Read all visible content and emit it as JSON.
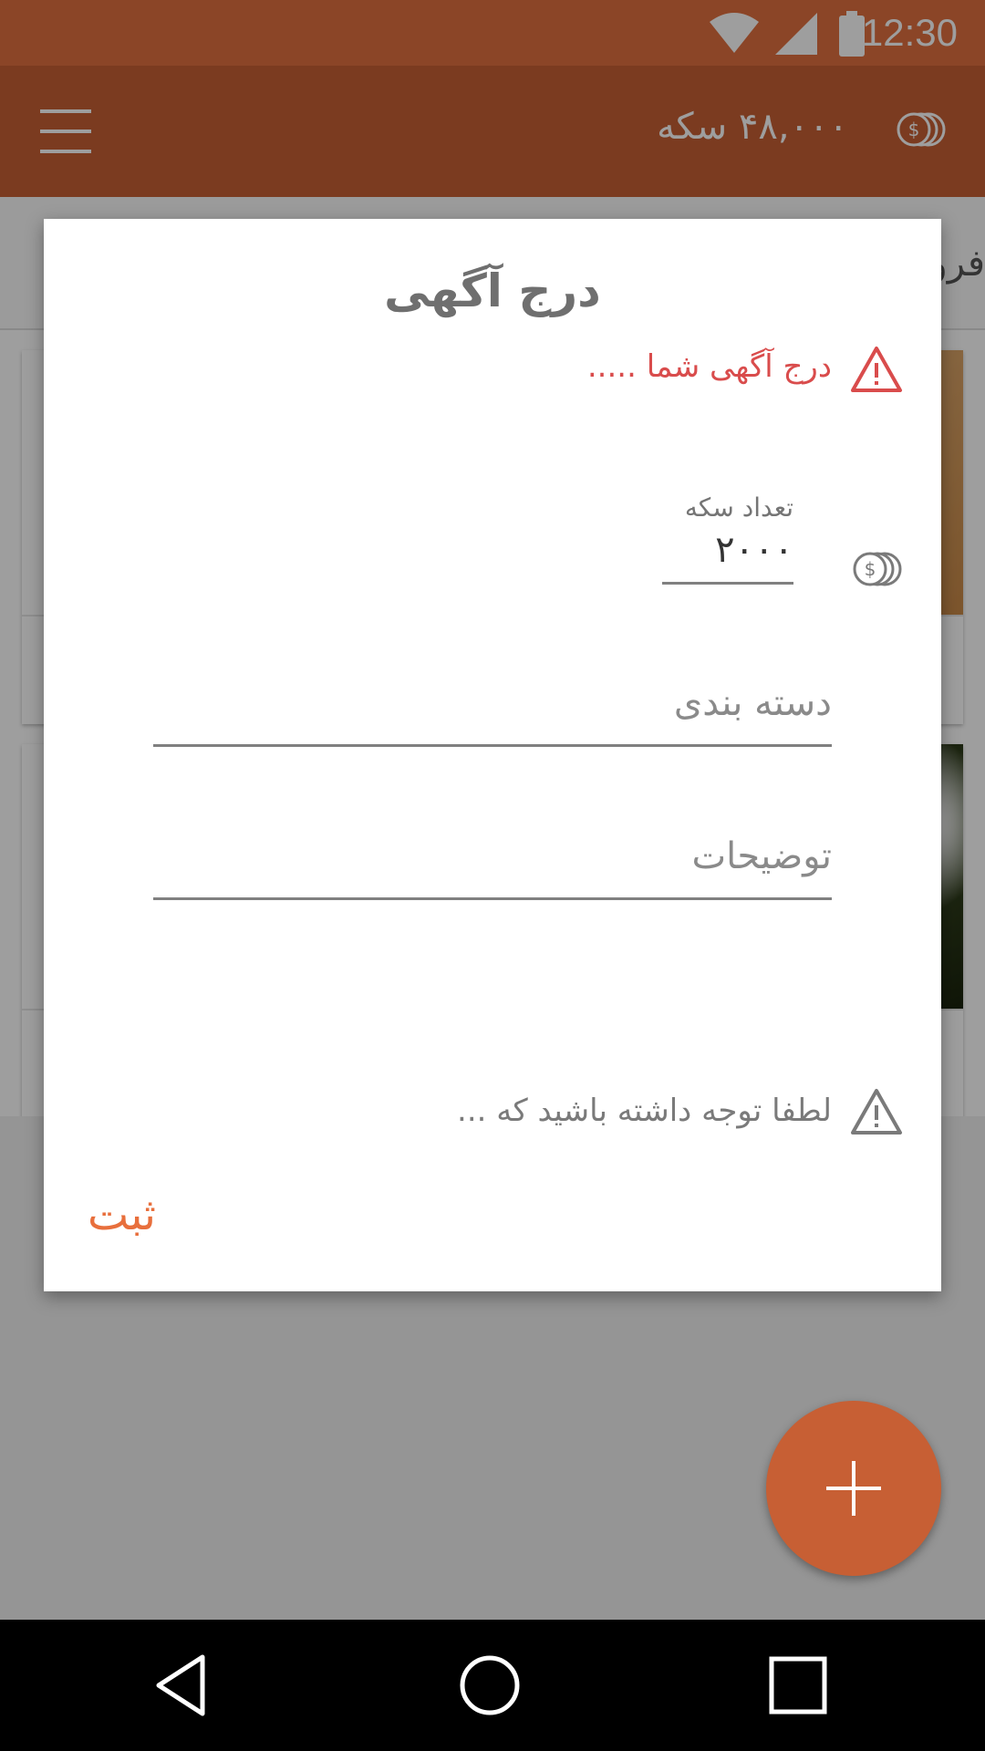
{
  "status_bar": {
    "time": "12:30",
    "icons": [
      "wifi-icon",
      "cellular-signal-icon",
      "battery-icon"
    ]
  },
  "app_bar": {
    "coin_balance": "۴۸,۰۰۰ سکه",
    "icons": [
      "menu-icon",
      "coins-icon"
    ],
    "color": "#C75F34"
  },
  "background": {
    "tab_label": "فرو"
  },
  "dialog": {
    "title": "درج آگهی",
    "alert_text": "درج آگهی شما .....",
    "coin_field": {
      "label": "تعداد سکه",
      "value": "۲۰۰۰"
    },
    "category_placeholder": "دسته بندی",
    "description_placeholder": "توضیحات",
    "note_text": "لطفا توجه داشته باشید که ...",
    "submit_label": "ثبت"
  },
  "colors": {
    "status_bar": "#E0703F",
    "primary": "#C75F34",
    "accent": "#E86F3C",
    "alert": "#D94C4C"
  }
}
